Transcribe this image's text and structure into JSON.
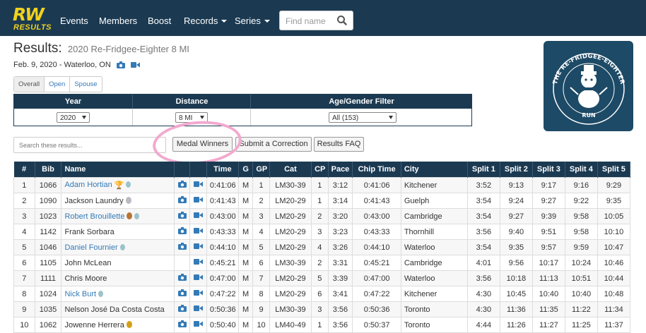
{
  "nav": {
    "logo_top": "RW",
    "logo_bottom": "RESULTS",
    "items": [
      {
        "label": "Events",
        "dropdown": false
      },
      {
        "label": "Members",
        "dropdown": false
      },
      {
        "label": "Boost",
        "dropdown": false
      },
      {
        "label": "Records",
        "dropdown": true
      },
      {
        "label": "Series",
        "dropdown": true
      }
    ],
    "search_placeholder": "Find name"
  },
  "page": {
    "title": "Results:",
    "subtitle": "2020 Re-Fridgee-Eighter 8 MI",
    "date_location": "Feb. 9, 2020 - Waterloo, ON",
    "tabs": [
      "Overall",
      "Open",
      "Spouse"
    ]
  },
  "filters": {
    "year_label": "Year",
    "year_value": "2020",
    "distance_label": "Distance",
    "distance_value": "8 MI",
    "age_label": "Age/Gender Filter",
    "age_value": "All (153)"
  },
  "poster": {
    "text": "THE RE-FRIDGEE-EIGHTER",
    "run": "RUN"
  },
  "tools": {
    "search_placeholder": "Search these results...",
    "medal_button": "Medal Winners",
    "correction_button": "Submit a Correction",
    "faq_button": "Results FAQ"
  },
  "table": {
    "headers": [
      "#",
      "Bib",
      "Name",
      "",
      "",
      "Time",
      "G",
      "GP",
      "Cat",
      "CP",
      "Pace",
      "Chip Time",
      "City",
      "Split 1",
      "Split 2",
      "Split 3",
      "Split 4",
      "Split 5"
    ],
    "rows": [
      {
        "pos": "1",
        "bib": "1066",
        "name": "Adam Hortian",
        "link": true,
        "trophy": true,
        "medal": "merit",
        "photo": true,
        "video": true,
        "time": "0:41:06",
        "g": "M",
        "gp": "1",
        "cat": "LM30-39",
        "cp": "1",
        "pace": "3:12",
        "chip": "0:41:06",
        "city": "Kitchener",
        "s1": "3:52",
        "s2": "9:13",
        "s3": "9:17",
        "s4": "9:16",
        "s5": "9:29"
      },
      {
        "pos": "2",
        "bib": "1090",
        "name": "Jackson Laundry",
        "link": false,
        "trophy": false,
        "medal": "silver",
        "photo": true,
        "video": true,
        "time": "0:41:43",
        "g": "M",
        "gp": "2",
        "cat": "LM20-29",
        "cp": "1",
        "pace": "3:14",
        "chip": "0:41:43",
        "city": "Guelph",
        "s1": "3:54",
        "s2": "9:24",
        "s3": "9:27",
        "s4": "9:22",
        "s5": "9:35"
      },
      {
        "pos": "3",
        "bib": "1023",
        "name": "Robert Brouillette",
        "link": true,
        "trophy": false,
        "medal": "bronze",
        "medal2": "merit",
        "photo": true,
        "video": true,
        "time": "0:43:00",
        "g": "M",
        "gp": "3",
        "cat": "LM20-29",
        "cp": "2",
        "pace": "3:20",
        "chip": "0:43:00",
        "city": "Cambridge",
        "s1": "3:54",
        "s2": "9:27",
        "s3": "9:39",
        "s4": "9:58",
        "s5": "10:05"
      },
      {
        "pos": "4",
        "bib": "1142",
        "name": "Frank Sorbara",
        "link": false,
        "trophy": false,
        "medal": "",
        "photo": true,
        "video": true,
        "time": "0:43:33",
        "g": "M",
        "gp": "4",
        "cat": "LM20-29",
        "cp": "3",
        "pace": "3:23",
        "chip": "0:43:33",
        "city": "Thornhill",
        "s1": "3:56",
        "s2": "9:40",
        "s3": "9:51",
        "s4": "9:58",
        "s5": "10:10"
      },
      {
        "pos": "5",
        "bib": "1046",
        "name": "Daniel Fournier",
        "link": true,
        "trophy": false,
        "medal": "merit",
        "photo": true,
        "video": true,
        "time": "0:44:10",
        "g": "M",
        "gp": "5",
        "cat": "LM20-29",
        "cp": "4",
        "pace": "3:26",
        "chip": "0:44:10",
        "city": "Waterloo",
        "s1": "3:54",
        "s2": "9:35",
        "s3": "9:57",
        "s4": "9:59",
        "s5": "10:47"
      },
      {
        "pos": "6",
        "bib": "1105",
        "name": "John McLean",
        "link": false,
        "trophy": false,
        "medal": "",
        "photo": false,
        "video": true,
        "time": "0:45:21",
        "g": "M",
        "gp": "6",
        "cat": "LM30-39",
        "cp": "2",
        "pace": "3:31",
        "chip": "0:45:21",
        "city": "Cambridge",
        "s1": "4:01",
        "s2": "9:56",
        "s3": "10:17",
        "s4": "10:24",
        "s5": "10:46"
      },
      {
        "pos": "7",
        "bib": "1111",
        "name": "Chris Moore",
        "link": false,
        "trophy": false,
        "medal": "",
        "photo": true,
        "video": true,
        "time": "0:47:00",
        "g": "M",
        "gp": "7",
        "cat": "LM20-29",
        "cp": "5",
        "pace": "3:39",
        "chip": "0:47:00",
        "city": "Waterloo",
        "s1": "3:56",
        "s2": "10:18",
        "s3": "11:13",
        "s4": "10:51",
        "s5": "10:44"
      },
      {
        "pos": "8",
        "bib": "1024",
        "name": "Nick Burt",
        "link": true,
        "trophy": false,
        "medal": "merit",
        "photo": true,
        "video": true,
        "time": "0:47:22",
        "g": "M",
        "gp": "8",
        "cat": "LM20-29",
        "cp": "6",
        "pace": "3:41",
        "chip": "0:47:22",
        "city": "Kitchener",
        "s1": "4:30",
        "s2": "10:45",
        "s3": "10:40",
        "s4": "10:40",
        "s5": "10:48"
      },
      {
        "pos": "9",
        "bib": "1035",
        "name": "Nelson José Da Costa Costa",
        "link": false,
        "trophy": false,
        "medal": "",
        "photo": true,
        "video": true,
        "time": "0:50:36",
        "g": "M",
        "gp": "9",
        "cat": "LM30-39",
        "cp": "3",
        "pace": "3:56",
        "chip": "0:50:36",
        "city": "Toronto",
        "s1": "4:30",
        "s2": "11:36",
        "s3": "11:35",
        "s4": "11:22",
        "s5": "11:34"
      },
      {
        "pos": "10",
        "bib": "1062",
        "name": "Jowenne Herrera",
        "link": false,
        "trophy": false,
        "medal": "gold",
        "photo": true,
        "video": true,
        "time": "0:50:40",
        "g": "M",
        "gp": "10",
        "cat": "LM40-49",
        "cp": "1",
        "pace": "3:56",
        "chip": "0:50:37",
        "city": "Toronto",
        "s1": "4:44",
        "s2": "11:26",
        "s3": "11:27",
        "s4": "11:25",
        "s5": "11:37"
      }
    ]
  },
  "colors": {
    "nav_bg": "#1b3a52",
    "logo": "#f1d21c",
    "link": "#337ab7",
    "highlight": "#f2a9cf"
  }
}
